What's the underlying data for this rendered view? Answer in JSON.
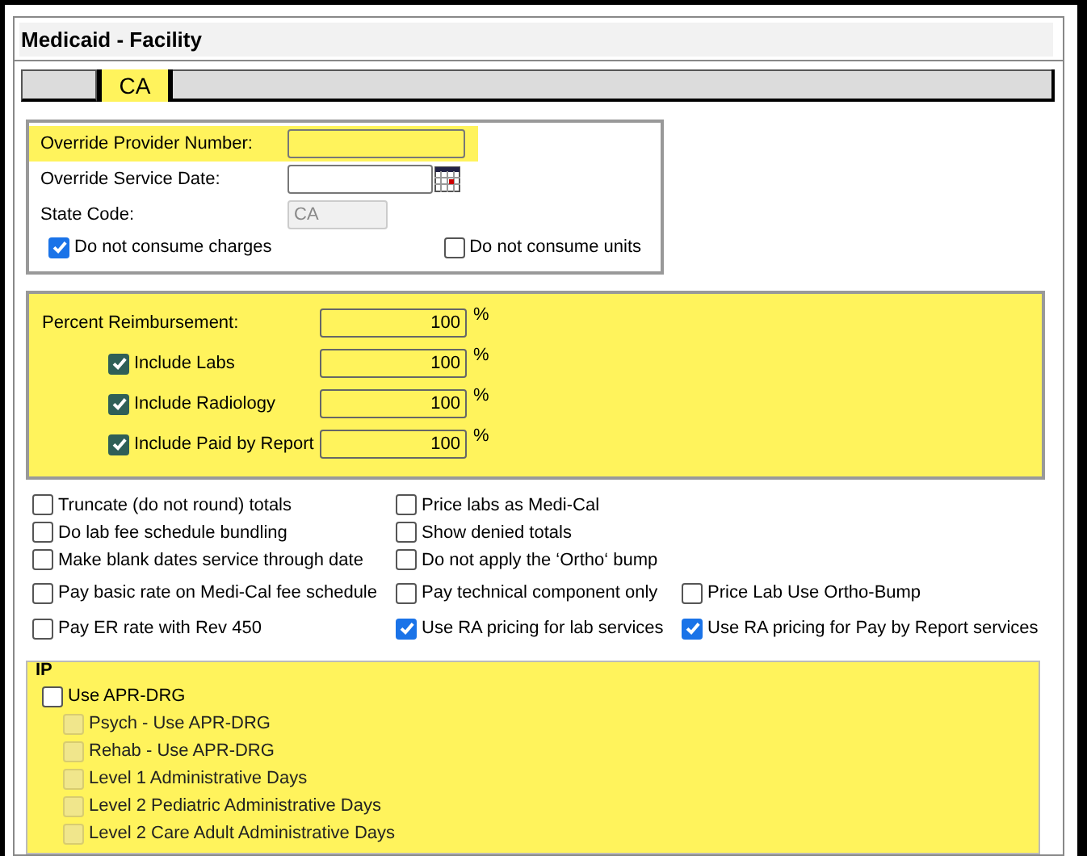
{
  "panel": {
    "title": "Medicaid - Facility"
  },
  "tabs": [
    {
      "selected": false
    },
    {
      "label": "CA",
      "selected": true
    }
  ],
  "override": {
    "fields": [
      {
        "kind": "text",
        "label": "Override Provider Number:",
        "highlighted": true
      },
      {
        "kind": "date",
        "label": "Override Service Date:",
        "highlighted": false
      },
      {
        "kind": "readonly",
        "label": "State Code:",
        "value": "CA",
        "highlighted": false
      }
    ],
    "options": [
      {
        "label": "Do not consume charges",
        "checked": true
      },
      {
        "label": "Do not consume units",
        "checked": false
      }
    ]
  },
  "reimbursement": {
    "highlighted": true,
    "rows": [
      {
        "kind": "plain",
        "label": "Percent Reimbursement:",
        "value": "100",
        "unit": "%"
      },
      {
        "kind": "check",
        "label": "Include Labs",
        "checked": true,
        "value": "100",
        "unit": "%"
      },
      {
        "kind": "check",
        "label": "Include Radiology",
        "checked": true,
        "value": "100",
        "unit": "%"
      },
      {
        "kind": "check",
        "label": "Include Paid by Report",
        "checked": true,
        "value": "100",
        "unit": "%"
      }
    ]
  },
  "options": [
    [
      {
        "label": "Truncate (do not round) totals",
        "checked": false
      },
      {
        "label": "Price labs as Medi-Cal",
        "checked": false
      }
    ],
    [
      {
        "label": "Do lab fee schedule bundling",
        "checked": false
      },
      {
        "label": "Show denied totals",
        "checked": false
      }
    ],
    [
      {
        "label": "Make blank dates service through date",
        "checked": false
      },
      {
        "label": "Do not apply the ‘Ortho‘ bump",
        "checked": false
      }
    ],
    [
      {
        "label": "Pay basic rate on Medi-Cal fee schedule",
        "checked": false
      },
      {
        "label": "Pay technical component only",
        "checked": false
      },
      {
        "label": "Price Lab Use Ortho-Bump",
        "checked": false
      }
    ],
    [
      {
        "label": "Pay ER rate with Rev 450",
        "checked": false
      },
      {
        "label": "Use RA pricing for lab services",
        "checked": true
      },
      {
        "label": "Use RA pricing for Pay by Report services",
        "checked": true
      }
    ]
  ],
  "ip": {
    "legend": "IP",
    "highlighted": true,
    "items": [
      {
        "label": "Use APR-DRG",
        "checked": false,
        "disabled": false,
        "children": [
          {
            "label": "Psych - Use APR-DRG",
            "checked": false,
            "disabled": true
          },
          {
            "label": "Rehab - Use APR-DRG",
            "checked": false,
            "disabled": true
          },
          {
            "label": "Level 1 Administrative Days",
            "checked": false,
            "disabled": true
          },
          {
            "label": "Level 2 Pediatric Administrative Days",
            "checked": false,
            "disabled": true
          },
          {
            "label": "Level 2 Care Adult Administrative Days",
            "checked": false,
            "disabled": true
          }
        ]
      }
    ]
  }
}
